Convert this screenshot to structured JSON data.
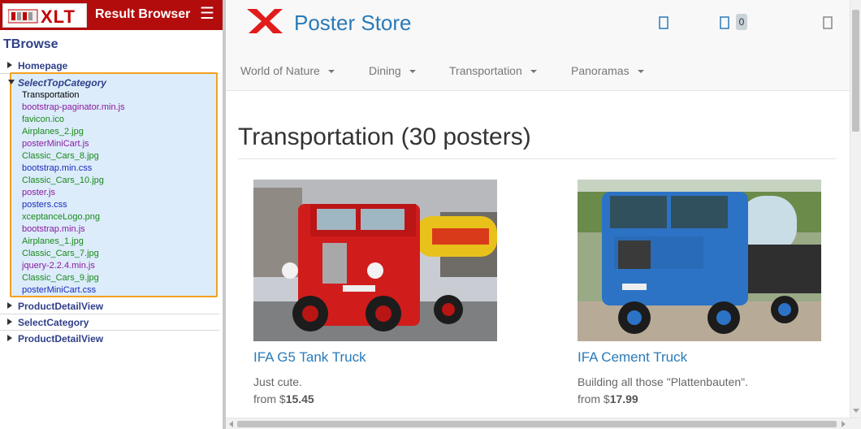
{
  "result_browser": {
    "logo_text": "XLT",
    "title": "Result Browser",
    "menu_icon": "hamburger-menu-icon",
    "tree_title": "TBrowse",
    "nodes": [
      {
        "label": "Homepage",
        "expanded": false
      },
      {
        "label": "SelectTopCategory",
        "expanded": true,
        "selected": true
      },
      {
        "label": "ProductDetailView",
        "expanded": false
      },
      {
        "label": "SelectCategory",
        "expanded": false
      },
      {
        "label": "ProductDetailView",
        "expanded": false
      }
    ],
    "selected_node": {
      "label": "SelectTopCategory",
      "requests": [
        {
          "name": "Transportation",
          "color": "#000000"
        },
        {
          "name": "bootstrap-paginator.min.js",
          "color": "#8a1a9e"
        },
        {
          "name": "favicon.ico",
          "color": "#1a8a1a"
        },
        {
          "name": "Airplanes_2.jpg",
          "color": "#1a8a1a"
        },
        {
          "name": "posterMiniCart.js",
          "color": "#8a1a9e"
        },
        {
          "name": "Classic_Cars_8.jpg",
          "color": "#1a8a1a"
        },
        {
          "name": "bootstrap.min.css",
          "color": "#1a2ab8"
        },
        {
          "name": "Classic_Cars_10.jpg",
          "color": "#1a8a1a"
        },
        {
          "name": "poster.js",
          "color": "#8a1a9e"
        },
        {
          "name": "posters.css",
          "color": "#1a2ab8"
        },
        {
          "name": "xceptanceLogo.png",
          "color": "#1a8a1a"
        },
        {
          "name": "bootstrap.min.js",
          "color": "#8a1a9e"
        },
        {
          "name": "Airplanes_1.jpg",
          "color": "#1a8a1a"
        },
        {
          "name": "Classic_Cars_7.jpg",
          "color": "#1a8a1a"
        },
        {
          "name": "jquery-2.2.4.min.js",
          "color": "#8a1a9e"
        },
        {
          "name": "Classic_Cars_9.jpg",
          "color": "#1a8a1a"
        },
        {
          "name": "posterMiniCart.css",
          "color": "#1a2ab8"
        }
      ]
    }
  },
  "store": {
    "title": "Poster Store",
    "logo_icon": "red-x-logo",
    "icons": [
      "search-icon",
      "cart-icon",
      "user-icon"
    ],
    "cart_count": "0",
    "categories": [
      "World of Nature",
      "Dining",
      "Transportation",
      "Panoramas"
    ],
    "heading": "Transportation (30 posters)",
    "products": [
      {
        "title": "IFA G5 Tank Truck",
        "desc": "Just cute.",
        "price_prefix": "from $",
        "price": "15.45"
      },
      {
        "title": "IFA Cement Truck",
        "desc": "Building all those \"Plattenbauten\".",
        "price_prefix": "from $",
        "price": "17.99"
      }
    ]
  },
  "colors": {
    "header_red": "#b30c0c",
    "highlight_border": "#f4a11e",
    "link_blue": "#2a7ab8"
  }
}
